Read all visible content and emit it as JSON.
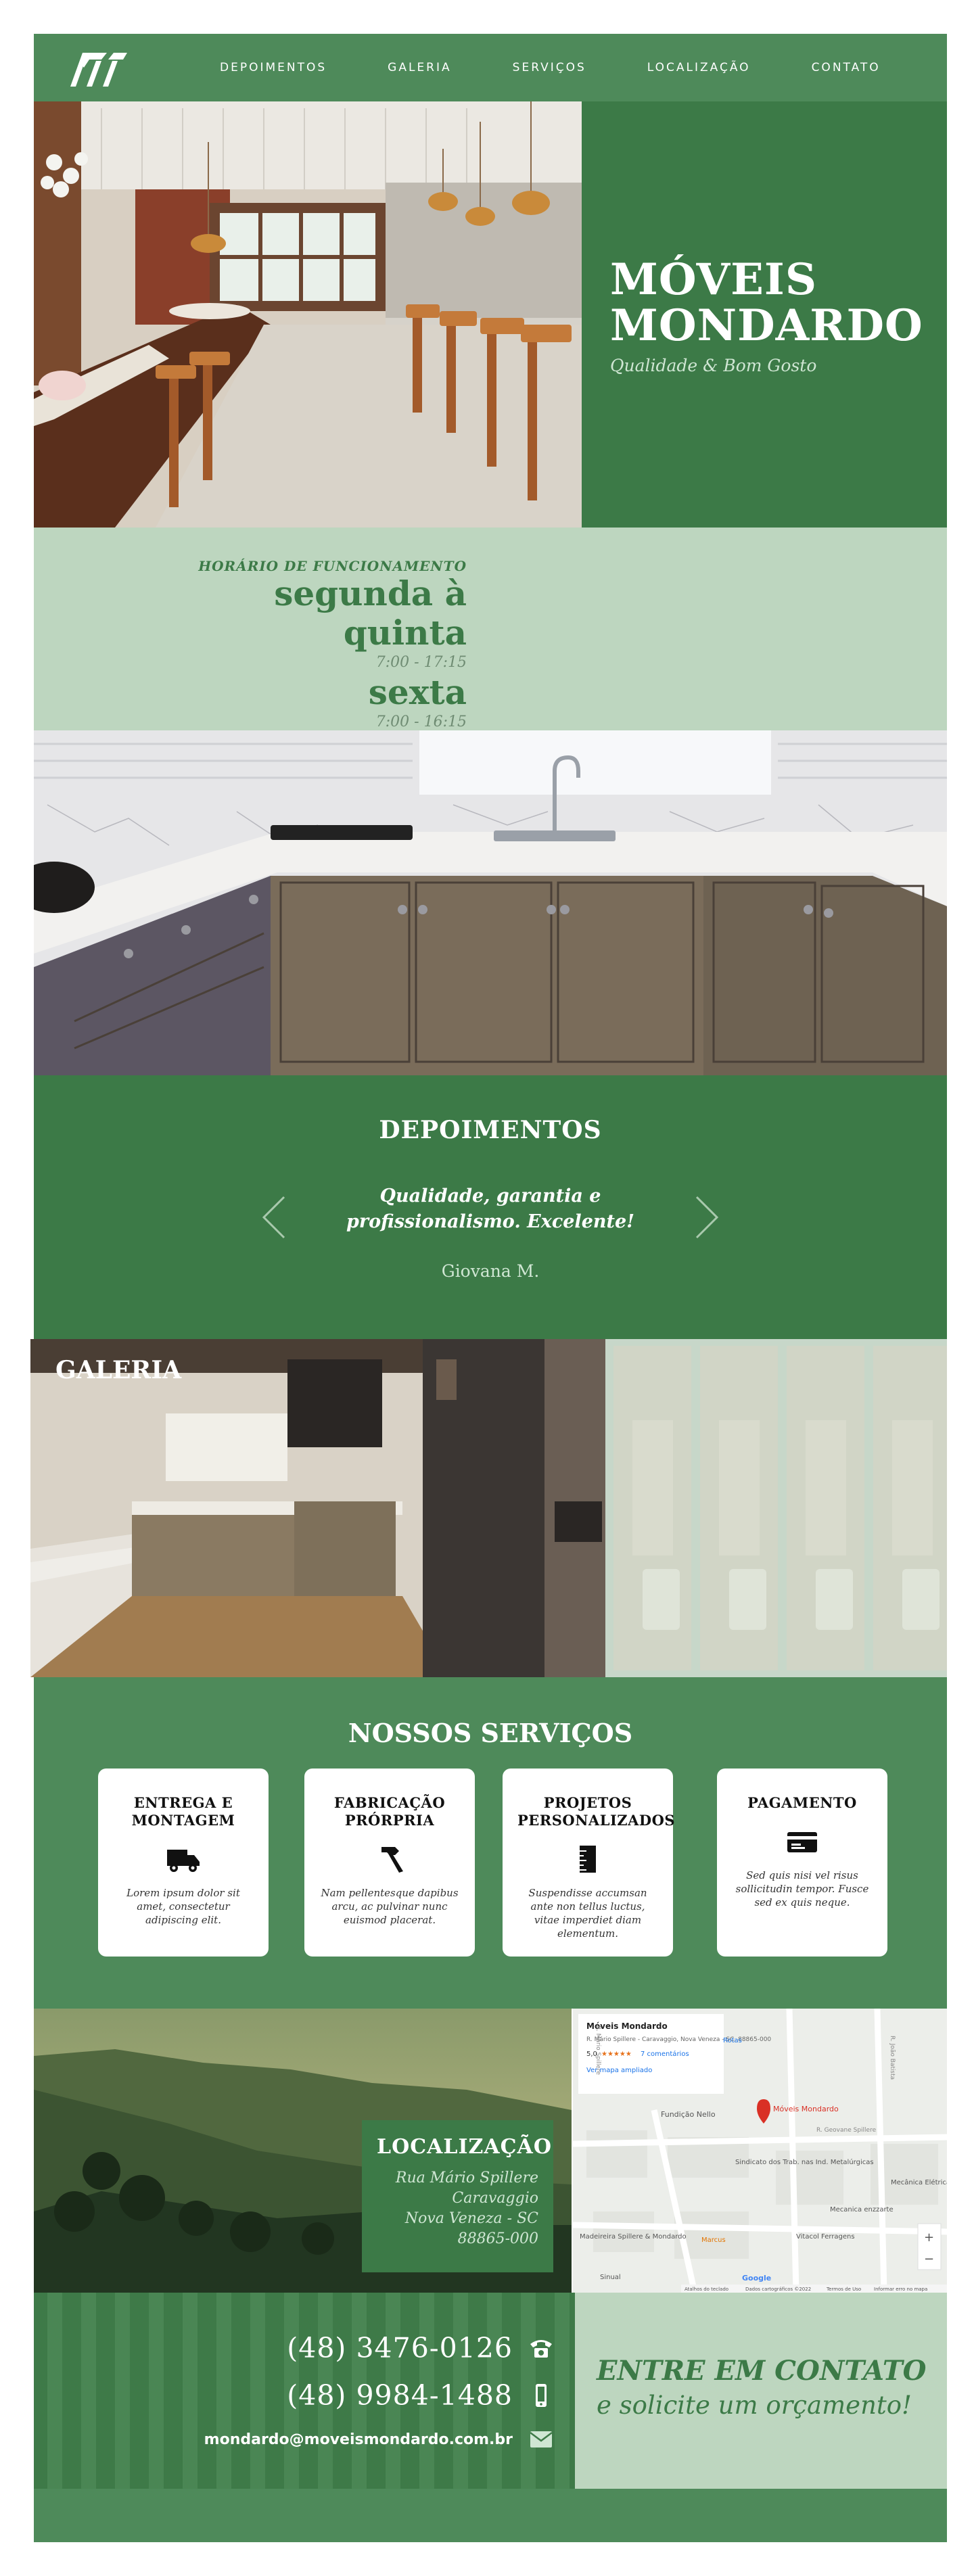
{
  "nav": {
    "items": [
      {
        "label": "DEPOIMENTOS"
      },
      {
        "label": "GALERIA"
      },
      {
        "label": "SERVIÇOS"
      },
      {
        "label": "LOCALIZAÇÃO"
      },
      {
        "label": "CONTATO"
      }
    ]
  },
  "hero": {
    "title_line1": "MÓVEIS",
    "title_line2": "MONDARDO",
    "subtitle": "Qualidade & Bom Gosto"
  },
  "hours": {
    "label": "HORÁRIO DE FUNCIONAMENTO",
    "day1": "segunda à quinta",
    "time1": "7:00 - 17:15",
    "day2": "sexta",
    "time2": "7:00 - 16:15"
  },
  "testimonials": {
    "title": "DEPOIMENTOS",
    "quote": "Qualidade, garantia e profissionalismo. Excelente!",
    "author": "Giovana M."
  },
  "gallery": {
    "title": "GALERIA"
  },
  "services": {
    "title": "NOSSOS SERVIÇOS",
    "cards": [
      {
        "title": "ENTREGA E MONTAGEM",
        "icon": "truck-icon",
        "text": "Lorem ipsum dolor sit amet, consectetur adipiscing elit."
      },
      {
        "title": "FABRICAÇÃO PRÓRPRIA",
        "icon": "hammer-icon",
        "text": "Nam pellentesque dapibus arcu, ac pulvinar nunc euismod placerat."
      },
      {
        "title": "PROJETOS PERSONALIZADOS",
        "icon": "ruler-icon",
        "text": "Suspendisse accumsan ante non tellus luctus, vitae imperdiet diam elementum."
      },
      {
        "title": "PAGAMENTO",
        "icon": "credit-card-icon",
        "text": "Sed quis nisi vel risus sollicitudin tempor. Fusce sed ex quis neque."
      }
    ]
  },
  "location": {
    "title": "LOCALIZAÇÃO",
    "line1": "Rua Mário Spillere",
    "line2": "Caravaggio",
    "line3": "Nova Veneza - SC",
    "line4": "88865-000"
  },
  "map": {
    "place_name": "Móveis Mondardo",
    "address": "R. Mário Spillere - Caravaggio, Nova Veneza - SC, 88865-000",
    "rating": "5,0",
    "stars": "★★★★★",
    "reviews": "7 comentários",
    "bigger_map": "Ver mapa ampliado",
    "routes": "Rotas",
    "pin_label": "Móveis Mondardo",
    "poi1": "Fundição Nello",
    "poi2": "Sindicato dos Trab. nas Ind. Metalúrgicas",
    "poi3": "Mecânica Elétrica C",
    "poi4": "Mecanica enzzarte",
    "poi5": "Madeireira Spillere & Mondardo",
    "poi6": "Marcus",
    "poi7": "Vitacol Ferragens",
    "poi8": "Sinual",
    "street1": "R. Mário Spillere",
    "street2": "R. João Batista",
    "street3": "R. Geovane Spillere",
    "google": "Google",
    "footer_shortcuts": "Atalhos do teclado",
    "footer_data": "Dados cartográficos ©2022",
    "footer_terms": "Termos de Uso",
    "footer_report": "Informar erro no mapa",
    "zoom_in": "+",
    "zoom_out": "−"
  },
  "contact": {
    "phone1": "(48) 3476-0126",
    "phone2": "(48) 9984-1488",
    "email": "mondardo@moveismondardo.com.br",
    "cta_title": "ENTRE EM CONTATO",
    "cta_sub": "e solicite um orçamento!"
  },
  "colors": {
    "dark_green": "#3c7a47",
    "mid_green": "#4e8a5a",
    "light_green": "#bdd6bf"
  }
}
